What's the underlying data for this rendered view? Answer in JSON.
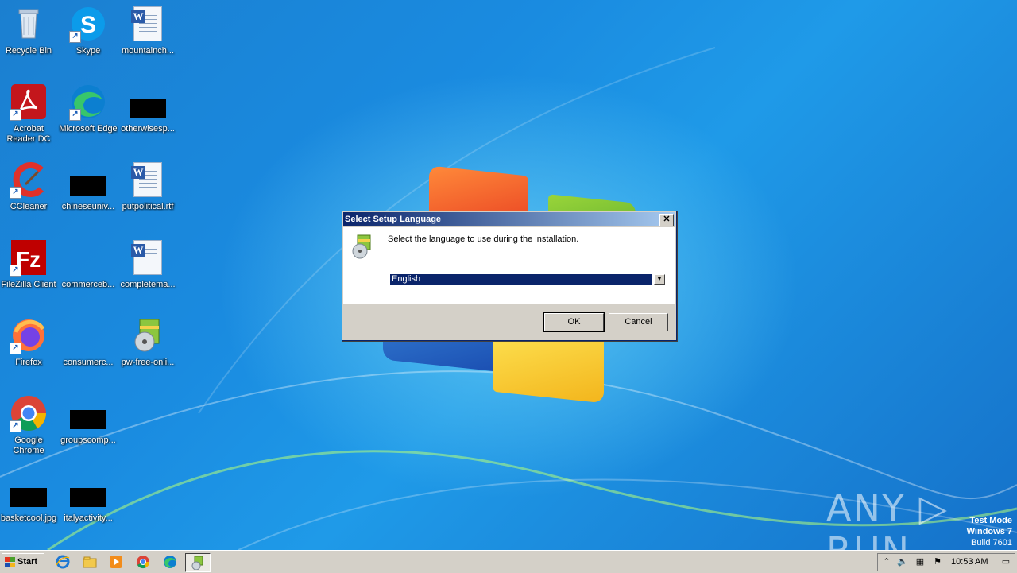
{
  "desktop": {
    "icons": [
      {
        "label": "Recycle Bin"
      },
      {
        "label": "Skype"
      },
      {
        "label": "mountainch..."
      },
      {
        "label": "Acrobat Reader DC"
      },
      {
        "label": "Microsoft Edge"
      },
      {
        "label": "otherwisesp..."
      },
      {
        "label": "CCleaner"
      },
      {
        "label": "chineseuniv..."
      },
      {
        "label": "putpolitical.rtf"
      },
      {
        "label": "FileZilla Client"
      },
      {
        "label": "commerceb..."
      },
      {
        "label": "completema..."
      },
      {
        "label": "Firefox"
      },
      {
        "label": "consumerc..."
      },
      {
        "label": "pw-free-onli..."
      },
      {
        "label": "Google Chrome"
      },
      {
        "label": "groupscomp..."
      },
      {
        "label": "basketcool.jpg"
      },
      {
        "label": "italyactivity..."
      }
    ]
  },
  "dialog": {
    "title": "Select Setup Language",
    "message": "Select the language to use during the installation.",
    "language_selected": "English",
    "ok_label": "OK",
    "cancel_label": "Cancel",
    "close_glyph": "✕"
  },
  "taskbar": {
    "start_label": "Start",
    "clock": "10:53 AM"
  },
  "watermark": {
    "line1": "Test Mode",
    "line2": "Windows 7",
    "line3": "Build 7601",
    "brand": "ANY ▷ RUN"
  }
}
